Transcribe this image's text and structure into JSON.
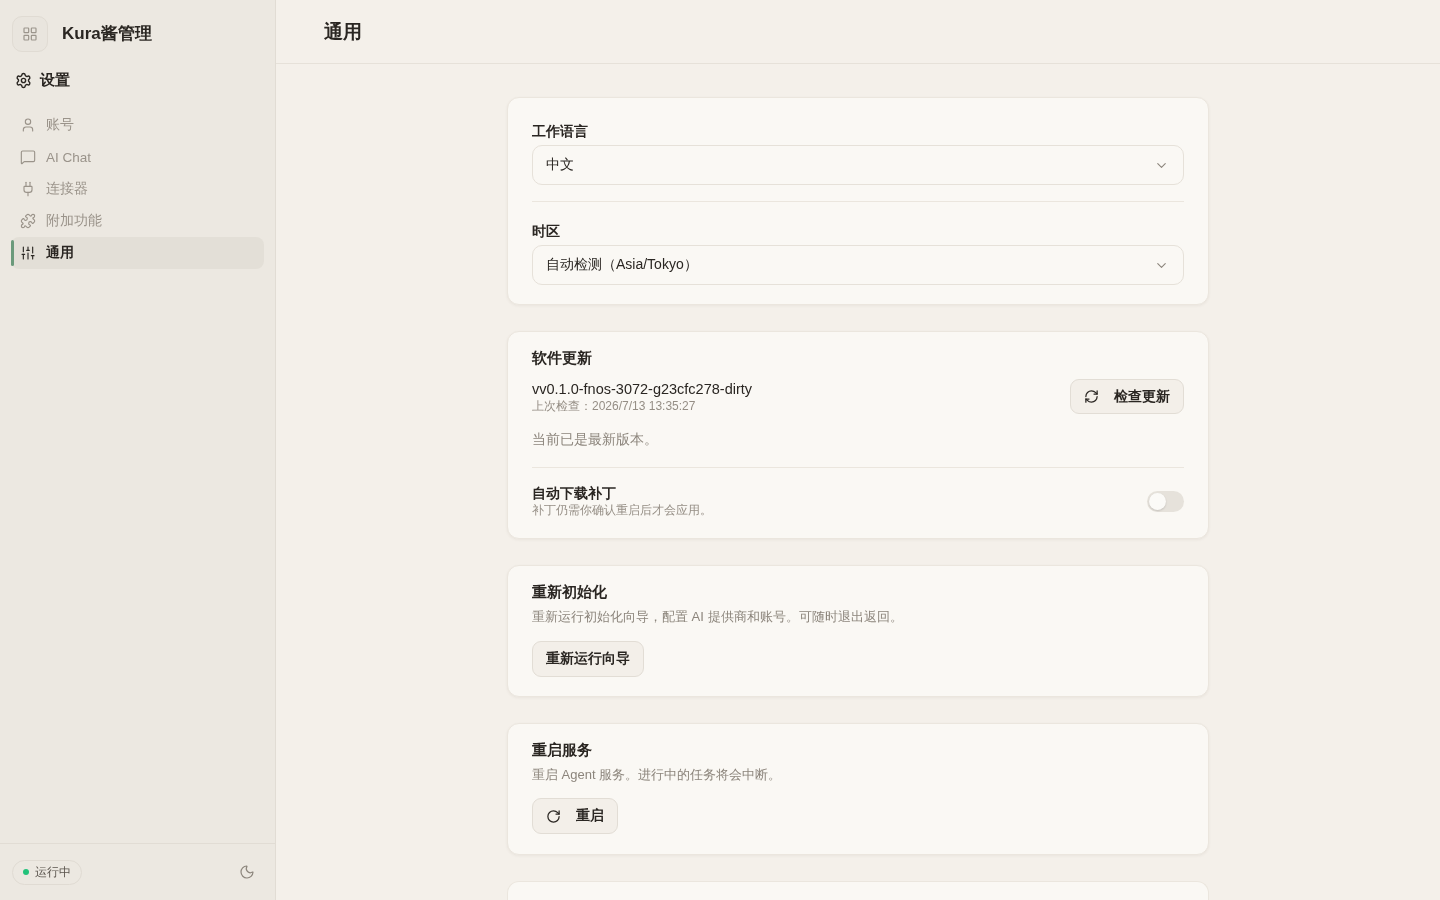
{
  "app": {
    "title": "Kura酱管理"
  },
  "sidebar": {
    "section_title": "设置",
    "items": [
      {
        "label": "账号",
        "selected": false
      },
      {
        "label": "AI Chat",
        "selected": false
      },
      {
        "label": "连接器",
        "selected": false
      },
      {
        "label": "附加功能",
        "selected": false
      },
      {
        "label": "通用",
        "selected": true
      }
    ],
    "status": {
      "label": "运行中"
    }
  },
  "header": {
    "title": "通用"
  },
  "general_card": {
    "fields": [
      {
        "label": "工作语言",
        "value": "中文"
      },
      {
        "label": "时区",
        "value": "自动检测（Asia/Tokyo）"
      }
    ]
  },
  "update_card": {
    "title": "软件更新",
    "version": "vv0.1.0-fnos-3072-g23cfc278-dirty",
    "last_check": "上次检查：2026/7/13 13:35:27",
    "button": "检查更新",
    "status": "当前已是最新版本。",
    "auto_patch": {
      "label": "自动下载补丁",
      "description": "补丁仍需你确认重启后才会应用。",
      "on": false
    }
  },
  "reinit_card": {
    "title": "重新初始化",
    "description": "重新运行初始化向导，配置 AI 提供商和账号。可随时退出返回。",
    "button": "重新运行向导"
  },
  "restart_card": {
    "title": "重启服务",
    "description": "重启 Agent 服务。进行中的任务将会中断。",
    "button": "重启"
  }
}
